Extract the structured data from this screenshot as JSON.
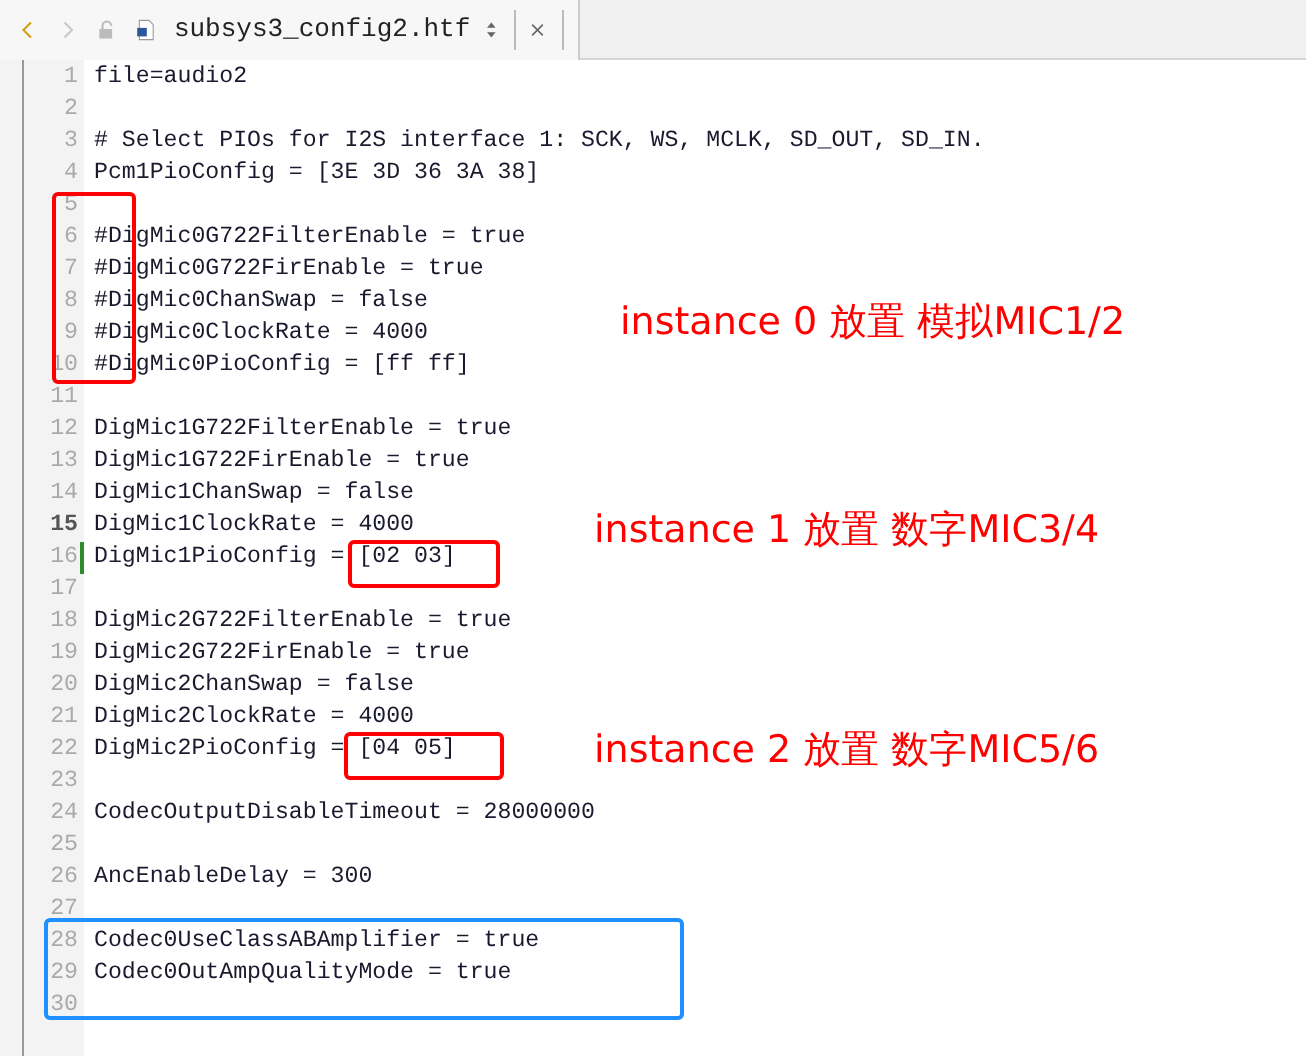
{
  "tab": {
    "title": "subsys3_config2.htf"
  },
  "lines": [
    {
      "number": "1",
      "text": "file=audio2",
      "current": false,
      "modified": false
    },
    {
      "number": "2",
      "current": false,
      "modified": false
    },
    {
      "number": "3",
      "text": "# Select PIOs for I2S interface 1: SCK, WS, MCLK, SD_OUT, SD_IN.",
      "current": false,
      "modified": false
    },
    {
      "number": "4",
      "text": "Pcm1PioConfig = [3E 3D 36 3A 38]",
      "current": false,
      "modified": false
    },
    {
      "number": "5",
      "current": false,
      "modified": false
    },
    {
      "number": "6",
      "text": "#DigMic0G722FilterEnable = true",
      "current": false,
      "modified": false
    },
    {
      "number": "7",
      "text": "#DigMic0G722FirEnable = true",
      "current": false,
      "modified": false
    },
    {
      "number": "8",
      "text": "#DigMic0ChanSwap = false",
      "current": false,
      "modified": false
    },
    {
      "number": "9",
      "text": "#DigMic0ClockRate = 4000",
      "current": false,
      "modified": false
    },
    {
      "number": "10",
      "text": "#DigMic0PioConfig = [ff ff]",
      "current": false,
      "modified": false
    },
    {
      "number": "11",
      "current": false,
      "modified": false
    },
    {
      "number": "12",
      "text": "DigMic1G722FilterEnable = true",
      "current": false,
      "modified": false
    },
    {
      "number": "13",
      "text": "DigMic1G722FirEnable = true",
      "current": false,
      "modified": false
    },
    {
      "number": "14",
      "text": "DigMic1ChanSwap = false",
      "current": false,
      "modified": false
    },
    {
      "number": "15",
      "text": "DigMic1ClockRate = 4000",
      "current": true,
      "modified": false
    },
    {
      "number": "16",
      "text": "DigMic1PioConfig = [02 03]",
      "current": false,
      "modified": true
    },
    {
      "number": "17",
      "current": false,
      "modified": false
    },
    {
      "number": "18",
      "text": "DigMic2G722FilterEnable = true",
      "current": false,
      "modified": false
    },
    {
      "number": "19",
      "text": "DigMic2G722FirEnable = true",
      "current": false,
      "modified": false
    },
    {
      "number": "20",
      "text": "DigMic2ChanSwap = false",
      "current": false,
      "modified": false
    },
    {
      "number": "21",
      "text": "DigMic2ClockRate = 4000",
      "current": false,
      "modified": false
    },
    {
      "number": "22",
      "text": "DigMic2PioConfig = [04 05]",
      "current": false,
      "modified": false
    },
    {
      "number": "23",
      "current": false,
      "modified": false
    },
    {
      "number": "24",
      "text": "CodecOutputDisableTimeout = 28000000",
      "current": false,
      "modified": false
    },
    {
      "number": "25",
      "current": false,
      "modified": false
    },
    {
      "number": "26",
      "text": "AncEnableDelay = 300",
      "current": false,
      "modified": false
    },
    {
      "number": "27",
      "current": false,
      "modified": false
    },
    {
      "number": "28",
      "text": "Codec0UseClassABAmplifier = true",
      "current": false,
      "modified": false
    },
    {
      "number": "29",
      "text": "Codec0OutAmpQualityMode = true",
      "current": false,
      "modified": false
    },
    {
      "number": "30",
      "current": false,
      "modified": false
    }
  ],
  "annotation_boxes": [
    {
      "color": "#ff0000"
    },
    {
      "color": "#ff0000"
    },
    {
      "color": "#ff0000"
    },
    {
      "color": "#1e90ff"
    }
  ],
  "annotation_notes": [
    {
      "text": "instance 0 放置 模拟MIC1/2",
      "color": "#ff0000"
    },
    {
      "text": "instance 1 放置 数字MIC3/4",
      "color": "#ff0000"
    },
    {
      "text": "instance 2 放置 数字MIC5/6",
      "color": "#ff0000"
    }
  ]
}
